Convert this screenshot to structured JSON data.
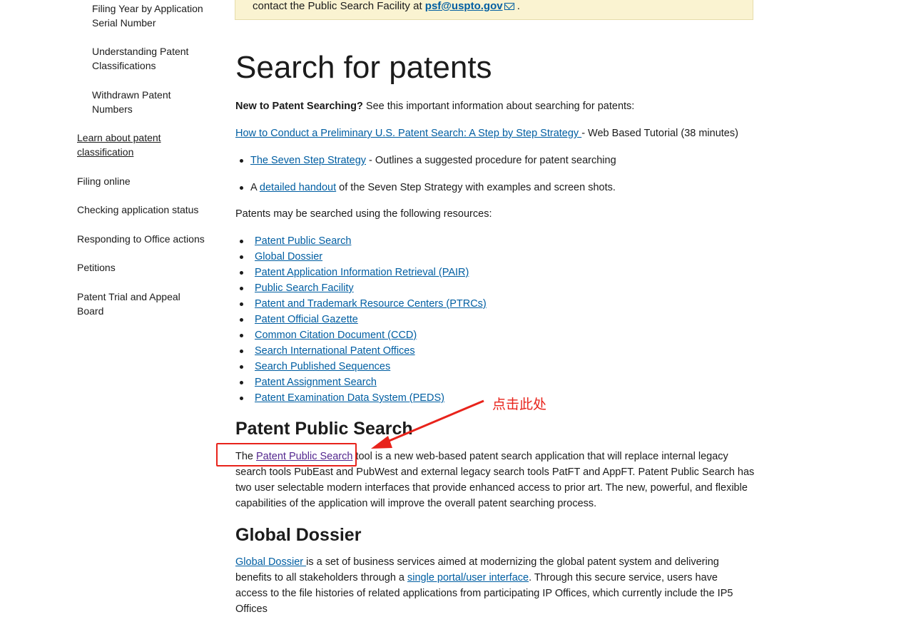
{
  "sidebar": {
    "items": [
      {
        "label": "Filing Year by Application Serial Number"
      },
      {
        "label": "Understanding Patent Classifications"
      },
      {
        "label": "Withdrawn Patent Numbers"
      },
      {
        "label": "Learn about patent classification"
      },
      {
        "label": "Filing online"
      },
      {
        "label": "Checking application status"
      },
      {
        "label": "Responding to Office actions"
      },
      {
        "label": "Petitions"
      },
      {
        "label": "Patent Trial and Appeal Board"
      }
    ]
  },
  "alert": {
    "text_before": "contact the Public Search Facility at ",
    "email": "psf@uspto.gov",
    "text_after": " ."
  },
  "main": {
    "title": "Search for patents",
    "intro_bold": "New to Patent Searching?",
    "intro_rest": " See this important information about searching for patents:",
    "tutorial_link": "How to Conduct a Preliminary U.S. Patent Search: A Step by Step Strategy ",
    "tutorial_rest": "- Web Based Tutorial (38 minutes)",
    "bullet1_link": "The Seven Step Strategy",
    "bullet1_rest": " - Outlines a suggested procedure for patent searching",
    "bullet2_pre": "A ",
    "bullet2_link": "detailed handout",
    "bullet2_rest": " of the Seven Step Strategy with examples and screen shots.",
    "resources_intro": "Patents may be searched using the following resources:",
    "resources": [
      "Patent Public Search",
      "Global Dossier",
      "Patent Application Information Retrieval (PAIR)",
      "Public Search Facility",
      "Patent and Trademark Resource Centers (PTRCs)",
      "Patent Official Gazette",
      "Common Citation Document (CCD)",
      "Search International Patent Offices",
      "Search Published Sequences",
      "Patent Assignment Search",
      "Patent Examination Data System (PEDS)"
    ],
    "pps_heading": "Patent Public Search",
    "pps_line1_pre": "The ",
    "pps_line1_link": "Patent Public Search",
    "pps_line1_rest": " tool is a new web-based patent search application that will replace internal legacy",
    "pps_line2": "search tools PubEast and PubWest and external legacy search tools PatFT and AppFT. Patent Public Search has",
    "pps_line3": "two user selectable modern interfaces that provide enhanced access to prior art. The new, powerful, and flexible",
    "pps_line4": "capabilities of the application will improve the overall patent searching process.",
    "gd_heading": "Global Dossier",
    "gd_line1_link": "Global Dossier ",
    "gd_line1_rest": "is a set of business services aimed at modernizing the global patent system and delivering",
    "gd_line2_pre": "benefits to all stakeholders through a ",
    "gd_line2_link": "single portal/user interface",
    "gd_line2_rest": ".  Through this secure service, users have",
    "gd_line3": "access to the file histories of related applications from participating IP Offices, which currently include the IP5",
    "gd_line4": "Offices"
  },
  "annotation": {
    "label": "点击此处",
    "color": "#e8231b"
  }
}
